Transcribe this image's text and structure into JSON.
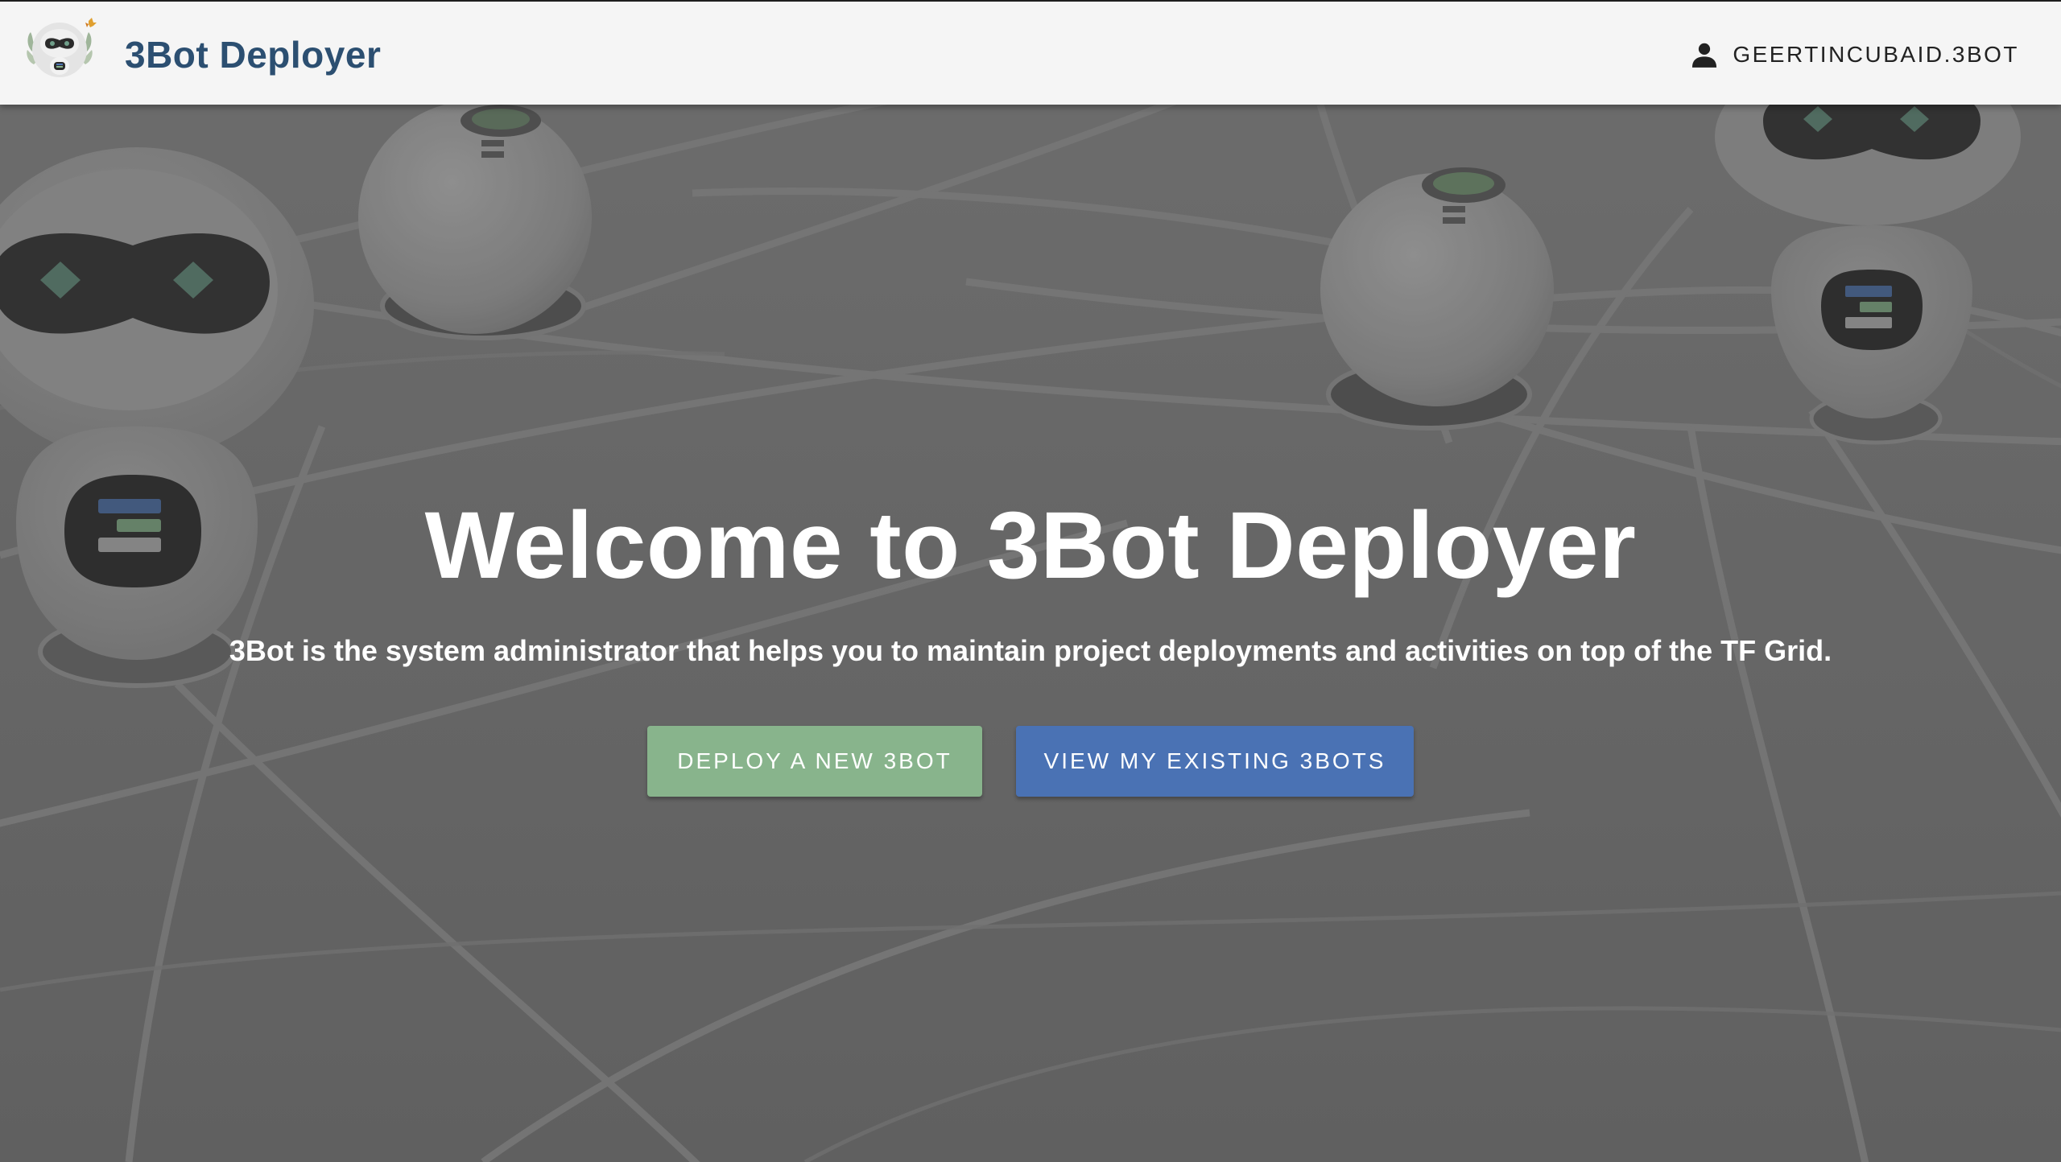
{
  "header": {
    "app_title": "3Bot Deployer",
    "user_name": "GEERTINCUBAID.3BOT",
    "logo_icon": "robot-logo-icon",
    "user_icon": "person-icon"
  },
  "hero": {
    "title": "Welcome to 3Bot Deployer",
    "subtitle": "3Bot is the system administrator that helps you to maintain project deployments and activities on top of the TF Grid.",
    "deploy_button": "DEPLOY A NEW 3BOT",
    "view_button": "VIEW MY EXISTING 3BOTS",
    "background_image": "robots-network-illustration"
  },
  "colors": {
    "header_bg": "#f5f5f5",
    "title_color": "#2c4f71",
    "deploy_button": "#88b48c",
    "view_button": "#4a72b4",
    "hero_overlay": "#666666"
  }
}
